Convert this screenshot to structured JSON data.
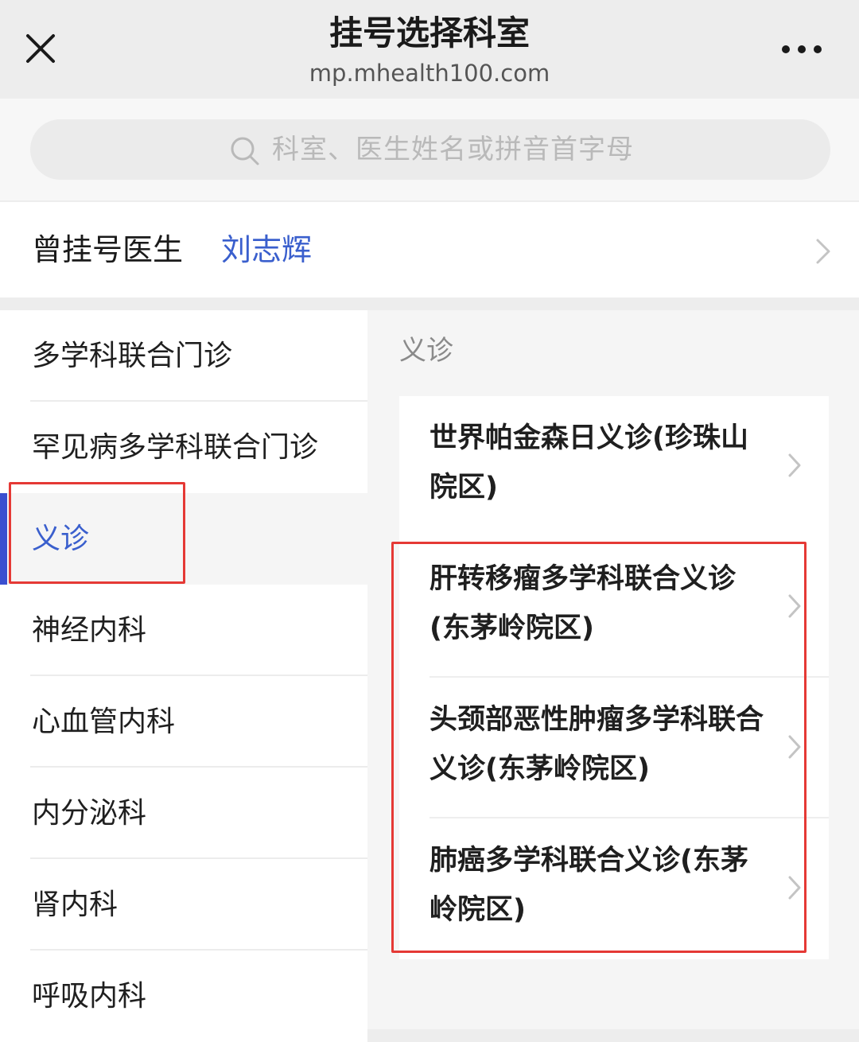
{
  "header": {
    "title": "挂号选择科室",
    "subtitle": "mp.mhealth100.com",
    "close_icon": "close-icon",
    "more_icon": "more-dots-icon"
  },
  "search": {
    "placeholder": "科室、医生姓名或拼音首字母",
    "icon": "search-icon"
  },
  "recent": {
    "label": "曾挂号医生",
    "doctor": "刘志辉"
  },
  "departments": [
    {
      "label": "多学科联合门诊",
      "active": false
    },
    {
      "label": "罕见病多学科联合门诊",
      "active": false
    },
    {
      "label": "义诊",
      "active": true
    },
    {
      "label": "神经内科",
      "active": false
    },
    {
      "label": "心血管内科",
      "active": false
    },
    {
      "label": "内分泌科",
      "active": false
    },
    {
      "label": "肾内科",
      "active": false
    },
    {
      "label": "呼吸内科",
      "active": false
    }
  ],
  "section": {
    "title": "义诊"
  },
  "clinics": [
    {
      "name": "世界帕金森日义诊(珍珠山院区)"
    },
    {
      "name": "肝转移瘤多学科联合义诊(东茅岭院区)"
    },
    {
      "name": "头颈部恶性肿瘤多学科联合义诊(东茅岭院区)"
    },
    {
      "name": "肺癌多学科联合义诊(东茅岭院区)"
    }
  ],
  "colors": {
    "accent": "#3a5fcd",
    "highlight_box": "#e53935"
  }
}
